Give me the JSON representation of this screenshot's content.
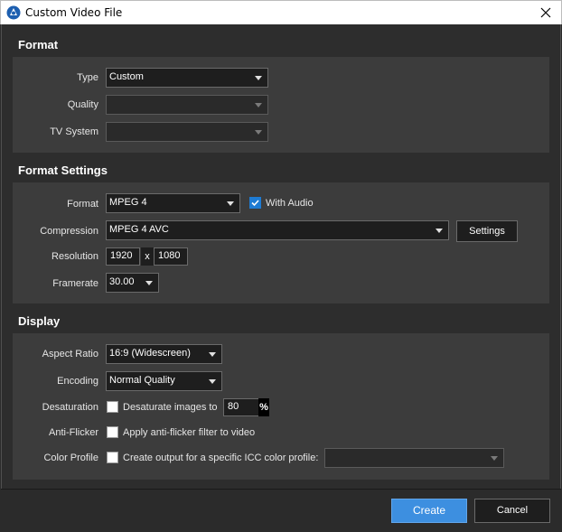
{
  "window": {
    "title": "Custom Video File"
  },
  "colors": {
    "accent": "#3d8fe0",
    "panel": "#3c3c3c",
    "background": "#2d2d2d"
  },
  "icons": {
    "app": "app-logo-icon",
    "close": "close-icon"
  },
  "format": {
    "heading": "Format",
    "type_label": "Type",
    "type_value": "Custom",
    "quality_label": "Quality",
    "quality_value": "",
    "tv_system_label": "TV System",
    "tv_system_value": ""
  },
  "format_settings": {
    "heading": "Format Settings",
    "format_label": "Format",
    "format_value": "MPEG 4",
    "with_audio_label": "With Audio",
    "with_audio_checked": true,
    "compression_label": "Compression",
    "compression_value": "MPEG 4 AVC",
    "settings_button": "Settings",
    "resolution_label": "Resolution",
    "resolution_width": "1920",
    "resolution_separator": "x",
    "resolution_height": "1080",
    "framerate_label": "Framerate",
    "framerate_value": "30.00"
  },
  "display": {
    "heading": "Display",
    "aspect_ratio_label": "Aspect Ratio",
    "aspect_ratio_value": "16:9 (Widescreen)",
    "encoding_label": "Encoding",
    "encoding_value": "Normal Quality",
    "desaturation_label": "Desaturation",
    "desaturate_text": "Desaturate images to",
    "desaturate_value": "80",
    "percent_sign": "%",
    "anti_flicker_label": "Anti-Flicker",
    "anti_flicker_text": "Apply anti-flicker filter to video",
    "color_profile_label": "Color Profile",
    "color_profile_text": "Create output for a specific ICC color profile:",
    "color_profile_value": ""
  },
  "footer": {
    "create_button": "Create",
    "cancel_button": "Cancel"
  }
}
